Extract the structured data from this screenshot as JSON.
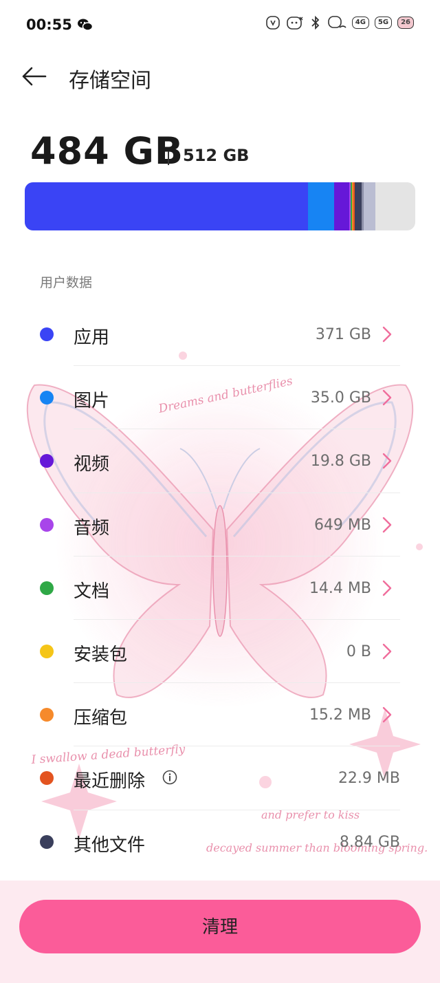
{
  "status_bar": {
    "time": "00:55",
    "icons": [
      "vibrate-icon",
      "alarm-icon",
      "bluetooth-icon",
      "wifi-icon",
      "signal-4g-icon",
      "signal-5g-icon",
      "battery-icon"
    ],
    "net1": "4G",
    "net2": "5G",
    "battery": "26"
  },
  "header": {
    "title": "存储空间"
  },
  "summary": {
    "used": "484 GB",
    "total": "512 GB"
  },
  "storage_bar": {
    "total_gb": 512,
    "segments": [
      {
        "name": "应用",
        "gb": 371,
        "color": "#3a44f5"
      },
      {
        "name": "图片",
        "gb": 35.0,
        "color": "#1784f3"
      },
      {
        "name": "视频",
        "gb": 19.8,
        "color": "#6618d8"
      },
      {
        "name": "音频",
        "gb": 0.649,
        "color": "#a845ea"
      },
      {
        "name": "文档",
        "gb": 0.0144,
        "color": "#2fa846"
      },
      {
        "name": "安装包",
        "gb": 0,
        "color": "#f5c518"
      },
      {
        "name": "压缩包",
        "gb": 0.0152,
        "color": "#f68a2b"
      },
      {
        "name": "最近删除",
        "gb": 0.0229,
        "color": "#e35420"
      },
      {
        "name": "其他文件",
        "gb": 8.84,
        "color": "#3a3f5c"
      },
      {
        "name": "system",
        "gb": 3.0,
        "color": "#8c8fa8"
      },
      {
        "name": "system2",
        "gb": 15.0,
        "color": "#babdd2"
      }
    ],
    "free_color": "#e4e4e4"
  },
  "section_label": "用户数据",
  "items": [
    {
      "label": "应用",
      "value": "371 GB",
      "color": "#3a44f5"
    },
    {
      "label": "图片",
      "value": "35.0 GB",
      "color": "#1784f3"
    },
    {
      "label": "视频",
      "value": "19.8 GB",
      "color": "#6618d8"
    },
    {
      "label": "音频",
      "value": "649 MB",
      "color": "#a845ea"
    },
    {
      "label": "文档",
      "value": "14.4 MB",
      "color": "#2fa846"
    },
    {
      "label": "安装包",
      "value": "0 B",
      "color": "#f5c518"
    },
    {
      "label": "压缩包",
      "value": "15.2 MB",
      "color": "#f68a2b"
    },
    {
      "label": "最近删除",
      "value": "22.9 MB",
      "color": "#e35420"
    },
    {
      "label": "其他文件",
      "value": "8.84 GB",
      "color": "#3a3f5c"
    }
  ],
  "wallpaper_text": {
    "line1": "Dreams and butterflies",
    "line2": "I swallow a dead butterfly",
    "line3": "and prefer to kiss",
    "line4": "decayed summer than blooming spring."
  },
  "accent_color": "#fb5c99",
  "chevron_color": "#f06d9c",
  "clean_button": {
    "label": "清理"
  }
}
